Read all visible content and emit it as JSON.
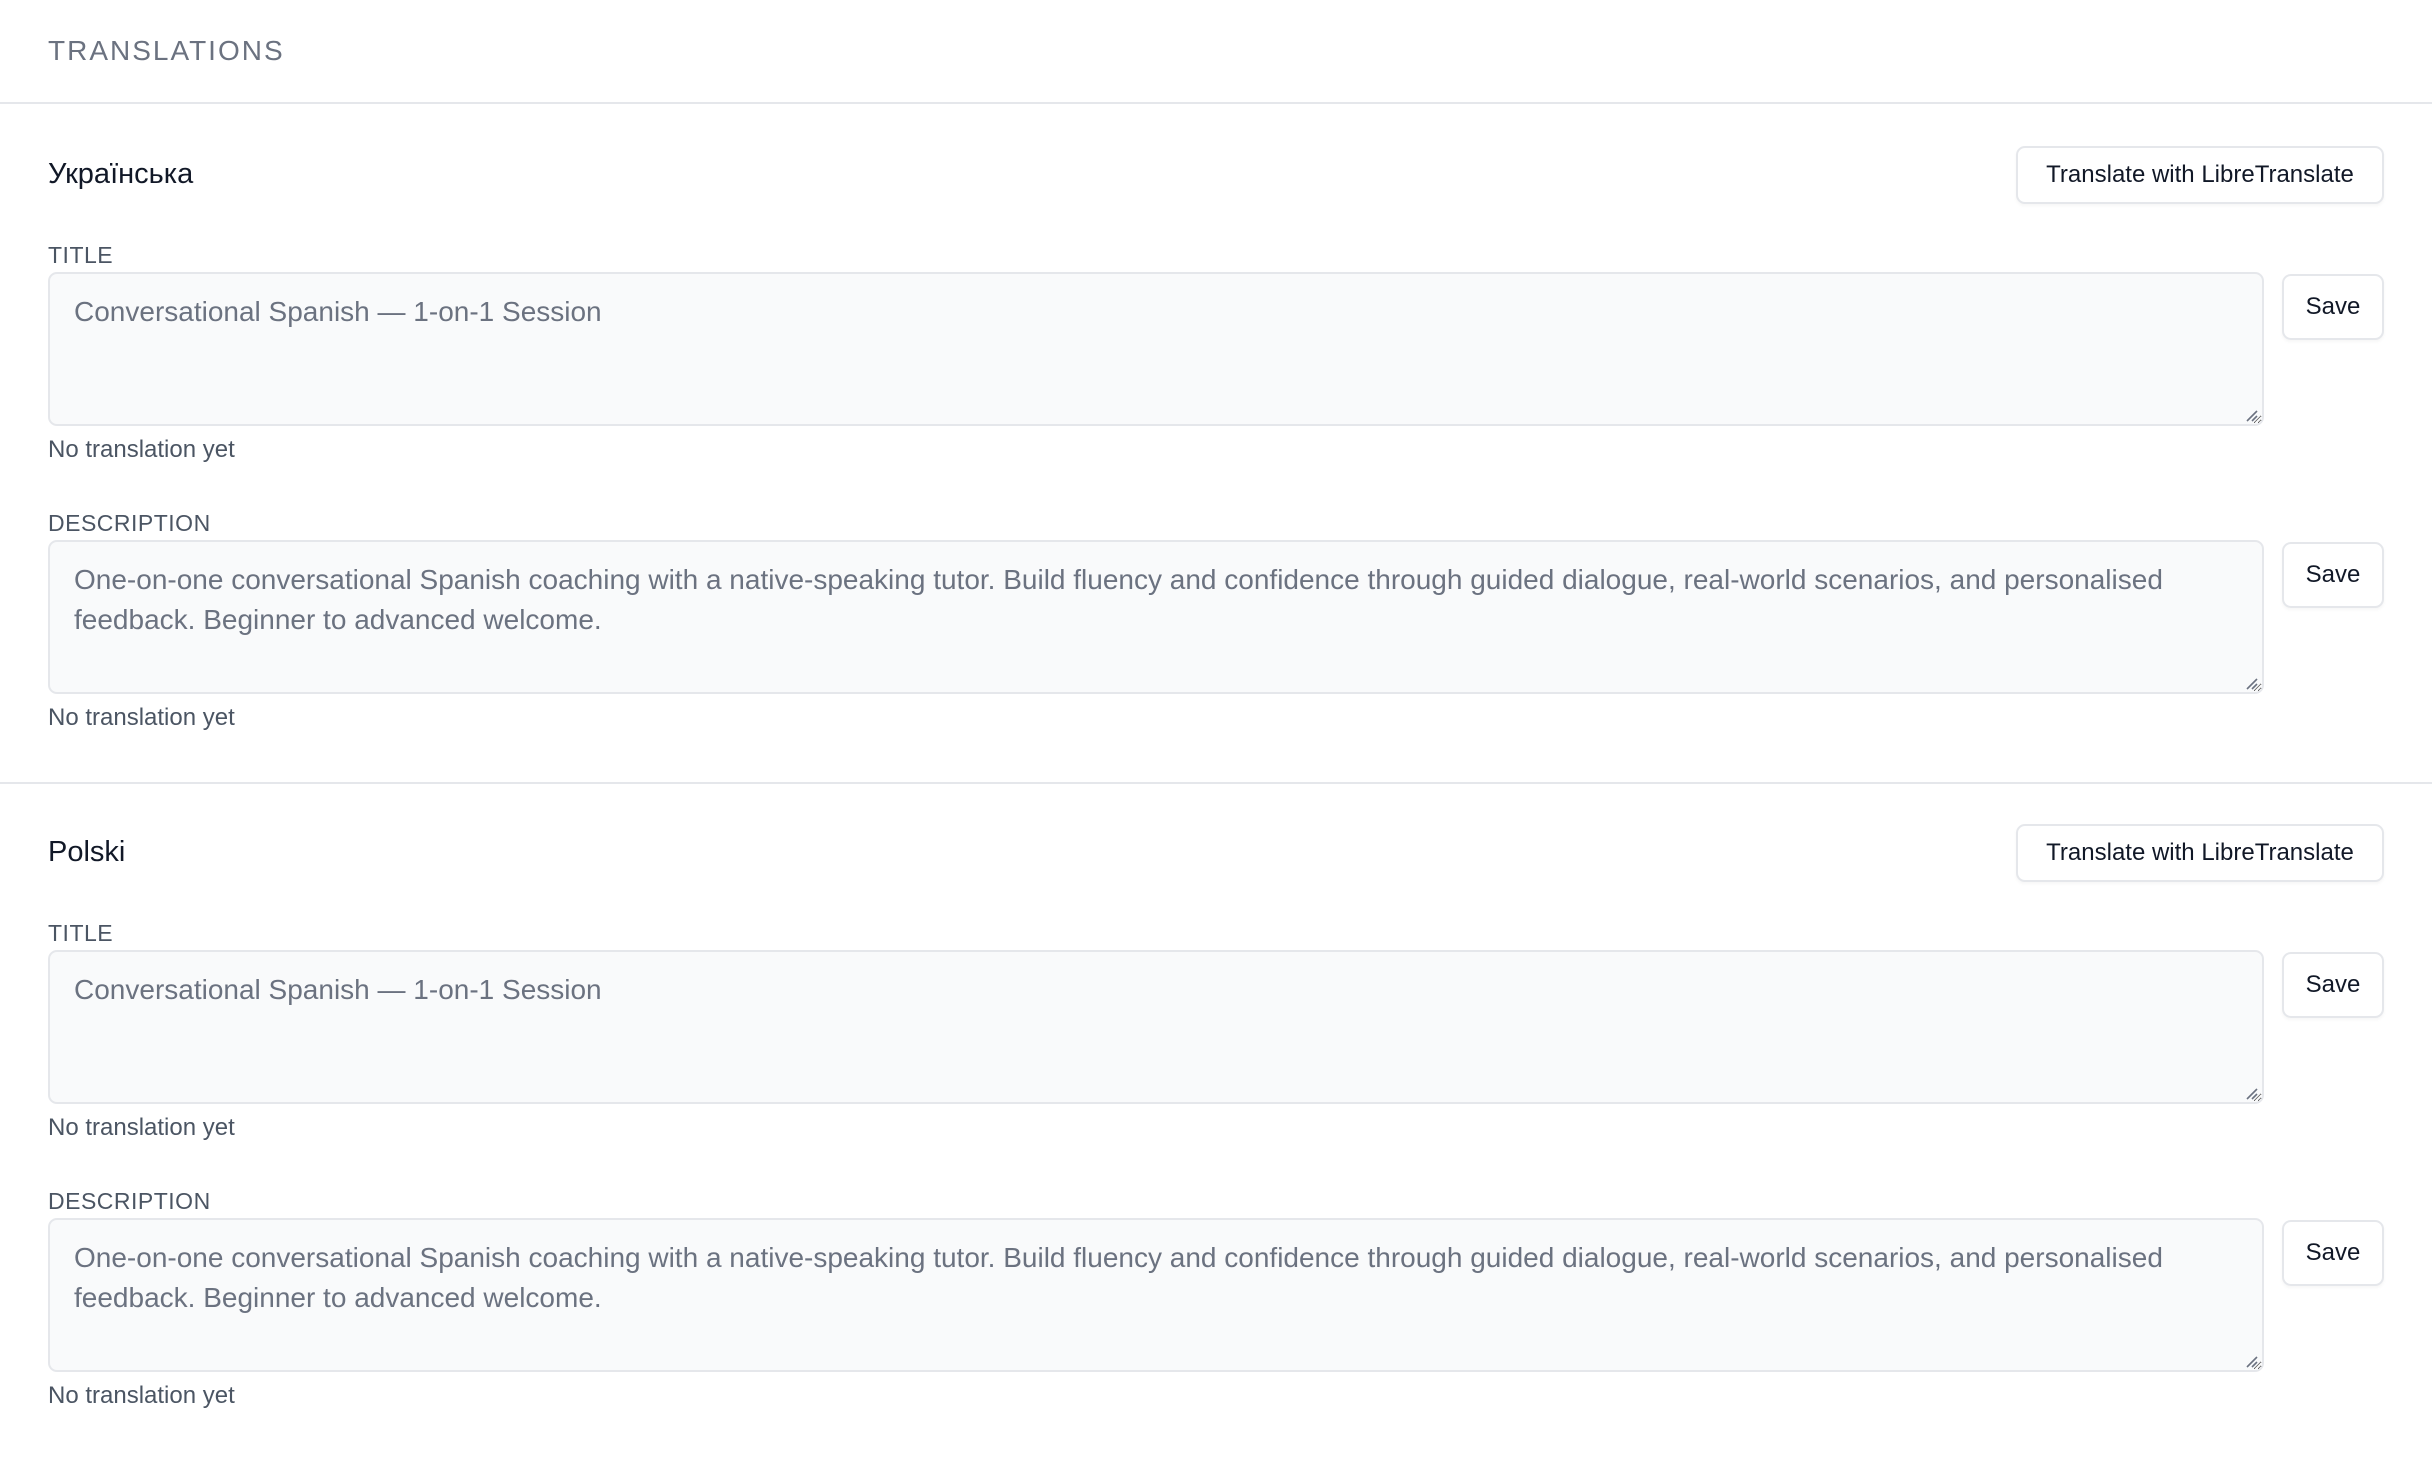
{
  "panel": {
    "title": "TRANSLATIONS"
  },
  "languages": [
    {
      "name": "Українська",
      "translate_label": "Translate with LibreTranslate",
      "fields": [
        {
          "label": "TITLE",
          "value": "Conversational Spanish — 1-on-1 Session",
          "save_label": "Save",
          "note": "No translation yet"
        },
        {
          "label": "DESCRIPTION",
          "value": "One-on-one conversational Spanish coaching with a native-speaking tutor. Build fluency and confidence through guided dialogue, real-world scenarios, and personalised feedback. Beginner to advanced welcome.",
          "save_label": "Save",
          "note": "No translation yet"
        }
      ]
    },
    {
      "name": "Polski",
      "translate_label": "Translate with LibreTranslate",
      "fields": [
        {
          "label": "TITLE",
          "value": "Conversational Spanish — 1-on-1 Session",
          "save_label": "Save",
          "note": "No translation yet"
        },
        {
          "label": "DESCRIPTION",
          "value": "One-on-one conversational Spanish coaching with a native-speaking tutor. Build fluency and confidence through guided dialogue, real-world scenarios, and personalised feedback. Beginner to advanced welcome.",
          "save_label": "Save",
          "note": "No translation yet"
        }
      ]
    }
  ],
  "colors": {
    "border": "#e5e7eb",
    "field_background": "#f9fafb",
    "muted_text": "#6b7280",
    "text": "#111827"
  }
}
